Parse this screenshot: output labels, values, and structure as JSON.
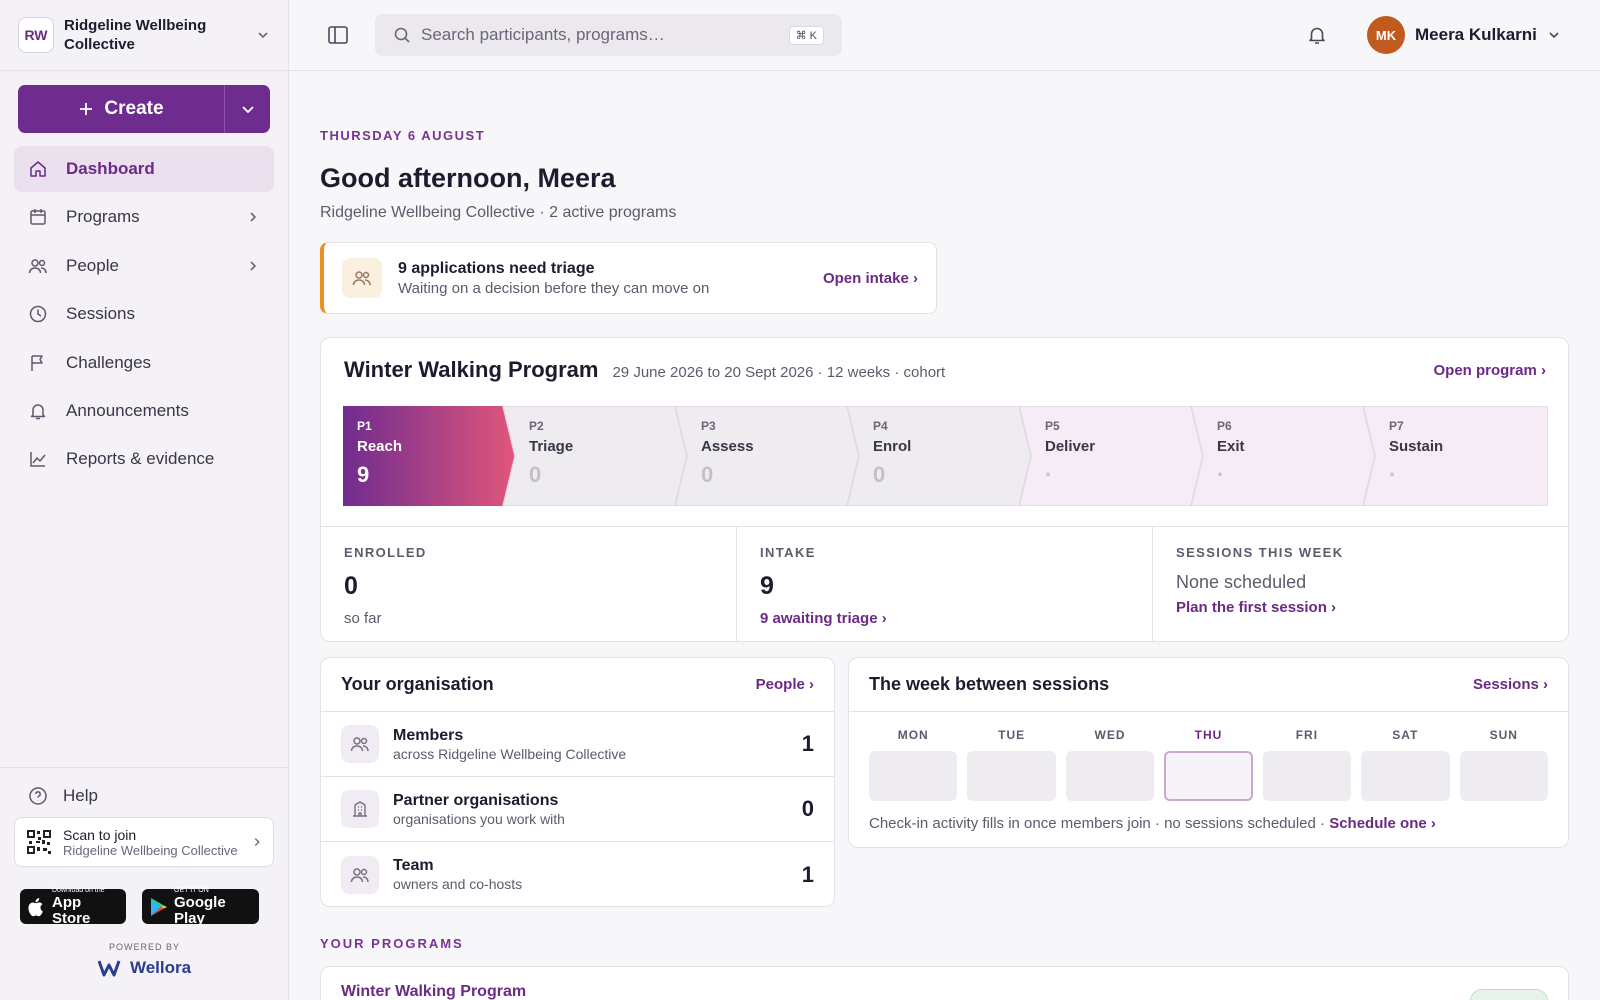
{
  "org": {
    "initials": "RW",
    "name": "Ridgeline Wellbeing Collective"
  },
  "sidebar": {
    "create_label": "Create",
    "nav": [
      {
        "label": "Dashboard",
        "icon": "home-icon"
      },
      {
        "label": "Programs",
        "icon": "calendar-icon"
      },
      {
        "label": "People",
        "icon": "people-icon"
      },
      {
        "label": "Sessions",
        "icon": "clock-icon"
      },
      {
        "label": "Challenges",
        "icon": "flag-icon"
      },
      {
        "label": "Announcements",
        "icon": "bell-icon"
      },
      {
        "label": "Reports & evidence",
        "icon": "chart-icon"
      }
    ],
    "help_label": "Help",
    "qr": {
      "title": "Scan to join",
      "subtitle": "Ridgeline Wellbeing Collective"
    },
    "app_store": {
      "small": "Download on the",
      "big": "App Store"
    },
    "google_play": {
      "small": "GET IT ON",
      "big": "Google Play"
    },
    "powered_by": "POWERED BY",
    "brand": "Wellora"
  },
  "topbar": {
    "search_placeholder": "Search participants, programs…",
    "shortcut": "⌘ K",
    "user": {
      "initials": "MK",
      "name": "Meera Kulkarni"
    }
  },
  "main": {
    "date": "THURSDAY 6 AUGUST",
    "greeting": "Good afternoon, Meera",
    "subline": "Ridgeline Wellbeing Collective · 2 active programs",
    "alert": {
      "title": "9 applications need triage",
      "subtitle": "Waiting on a decision before they can move on",
      "link": "Open intake ›"
    },
    "program": {
      "title": "Winter Walking Program",
      "meta": "29 June 2026 to 20 Sept 2026 · 12 weeks · cohort",
      "link": "Open program ›",
      "stages": [
        {
          "code": "P1",
          "name": "Reach",
          "count": "9"
        },
        {
          "code": "P2",
          "name": "Triage",
          "count": "0"
        },
        {
          "code": "P3",
          "name": "Assess",
          "count": "0"
        },
        {
          "code": "P4",
          "name": "Enrol",
          "count": "0"
        },
        {
          "code": "P5",
          "name": "Deliver",
          "count": "·"
        },
        {
          "code": "P6",
          "name": "Exit",
          "count": "·"
        },
        {
          "code": "P7",
          "name": "Sustain",
          "count": "·"
        }
      ],
      "stats": {
        "enrolled": {
          "label": "ENROLLED",
          "value": "0",
          "sub": "so far"
        },
        "intake": {
          "label": "INTAKE",
          "value": "9",
          "link": "9 awaiting triage ›"
        },
        "sessions": {
          "label": "SESSIONS THIS WEEK",
          "none": "None scheduled",
          "link": "Plan the first session ›"
        }
      }
    },
    "organisation": {
      "title": "Your organisation",
      "link": "People ›",
      "rows": [
        {
          "title": "Members",
          "sub": "across Ridgeline Wellbeing Collective",
          "count": "1"
        },
        {
          "title": "Partner organisations",
          "sub": "organisations you work with",
          "count": "0"
        },
        {
          "title": "Team",
          "sub": "owners and co-hosts",
          "count": "1"
        }
      ]
    },
    "week": {
      "title": "The week between sessions",
      "link": "Sessions ›",
      "days": [
        "MON",
        "TUE",
        "WED",
        "THU",
        "FRI",
        "SAT",
        "SUN"
      ],
      "today": "THU",
      "note": "Check-in activity fills in once members join · no sessions scheduled · ",
      "note_link": "Schedule one ›"
    },
    "programs_section": "YOUR PROGRAMS",
    "program_list": [
      {
        "title": "Winter Walking Program"
      }
    ]
  },
  "colors": {
    "accent": "#6f2c8f",
    "alert": "#e9921f",
    "reach_start": "#6f2c8f",
    "reach_end": "#e0567a"
  }
}
